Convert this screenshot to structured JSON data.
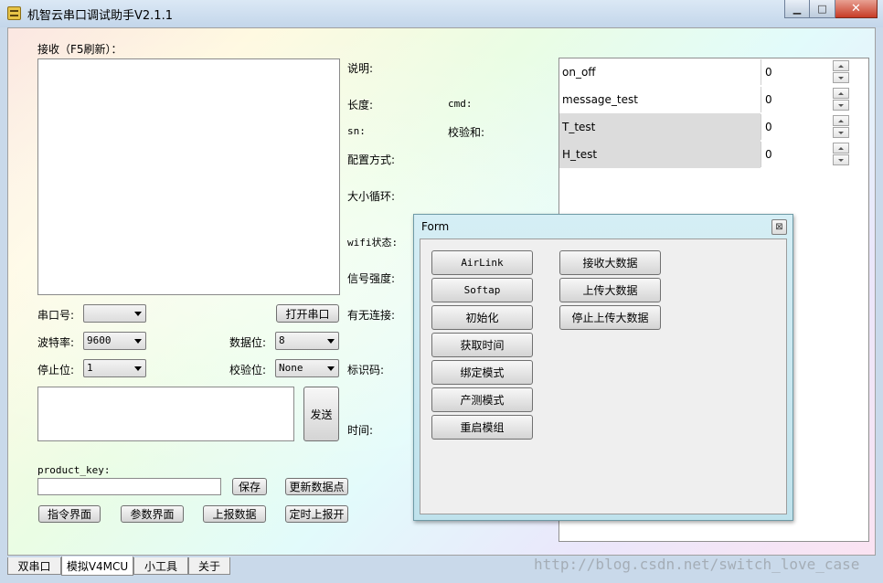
{
  "window": {
    "title": "机智云串口调试助手V2.1.1",
    "minimize_glyph": "▁",
    "maximize_glyph": "□",
    "close_glyph": "✕"
  },
  "receive": {
    "label": "接收（F5刷新）："
  },
  "info": {
    "description": "说明:",
    "length": "长度:",
    "cmd": "cmd:",
    "sn": "sn:",
    "checksum": "校验和:",
    "config_mode": "配置方式:",
    "endianness": "大小循环:",
    "wifi_status": "wifi状态:",
    "signal_strength": "信号强度:",
    "connection": "有无连接:",
    "id_code": "标识码:",
    "time": "时间:"
  },
  "serial": {
    "port_label": "串口号:",
    "port_value": "",
    "open_port": "打开串口",
    "baud_label": "波特率:",
    "baud_value": "9600",
    "databits_label": "数据位:",
    "databits_value": "8",
    "stopbits_label": "停止位:",
    "stopbits_value": "1",
    "parity_label": "校验位:",
    "parity_value": "None"
  },
  "send": {
    "button": "发送"
  },
  "product": {
    "label": "product_key:",
    "value": "",
    "save": "保存",
    "update_points": "更新数据点",
    "command_view": "指令界面",
    "param_view": "参数界面",
    "report_data": "上报数据",
    "timed_report": "定时上报开"
  },
  "datapoints": [
    {
      "name": "on_off",
      "value": "0",
      "shaded": false
    },
    {
      "name": "message_test",
      "value": "0",
      "shaded": false
    },
    {
      "name": "T_test",
      "value": "0",
      "shaded": true
    },
    {
      "name": "H_test",
      "value": "0",
      "shaded": true
    }
  ],
  "form": {
    "title": "Form",
    "close_glyph": "⊠",
    "left_buttons": [
      "AirLink",
      "Softap",
      "初始化",
      "获取时间",
      "绑定模式",
      "产测模式",
      "重启模组"
    ],
    "right_buttons": [
      "接收大数据",
      "上传大数据",
      "停止上传大数据"
    ]
  },
  "tabs": [
    "双串口",
    "模拟V4MCU",
    "小工具",
    "关于"
  ],
  "active_tab": 1,
  "watermark": "http://blog.csdn.net/switch_love_case"
}
